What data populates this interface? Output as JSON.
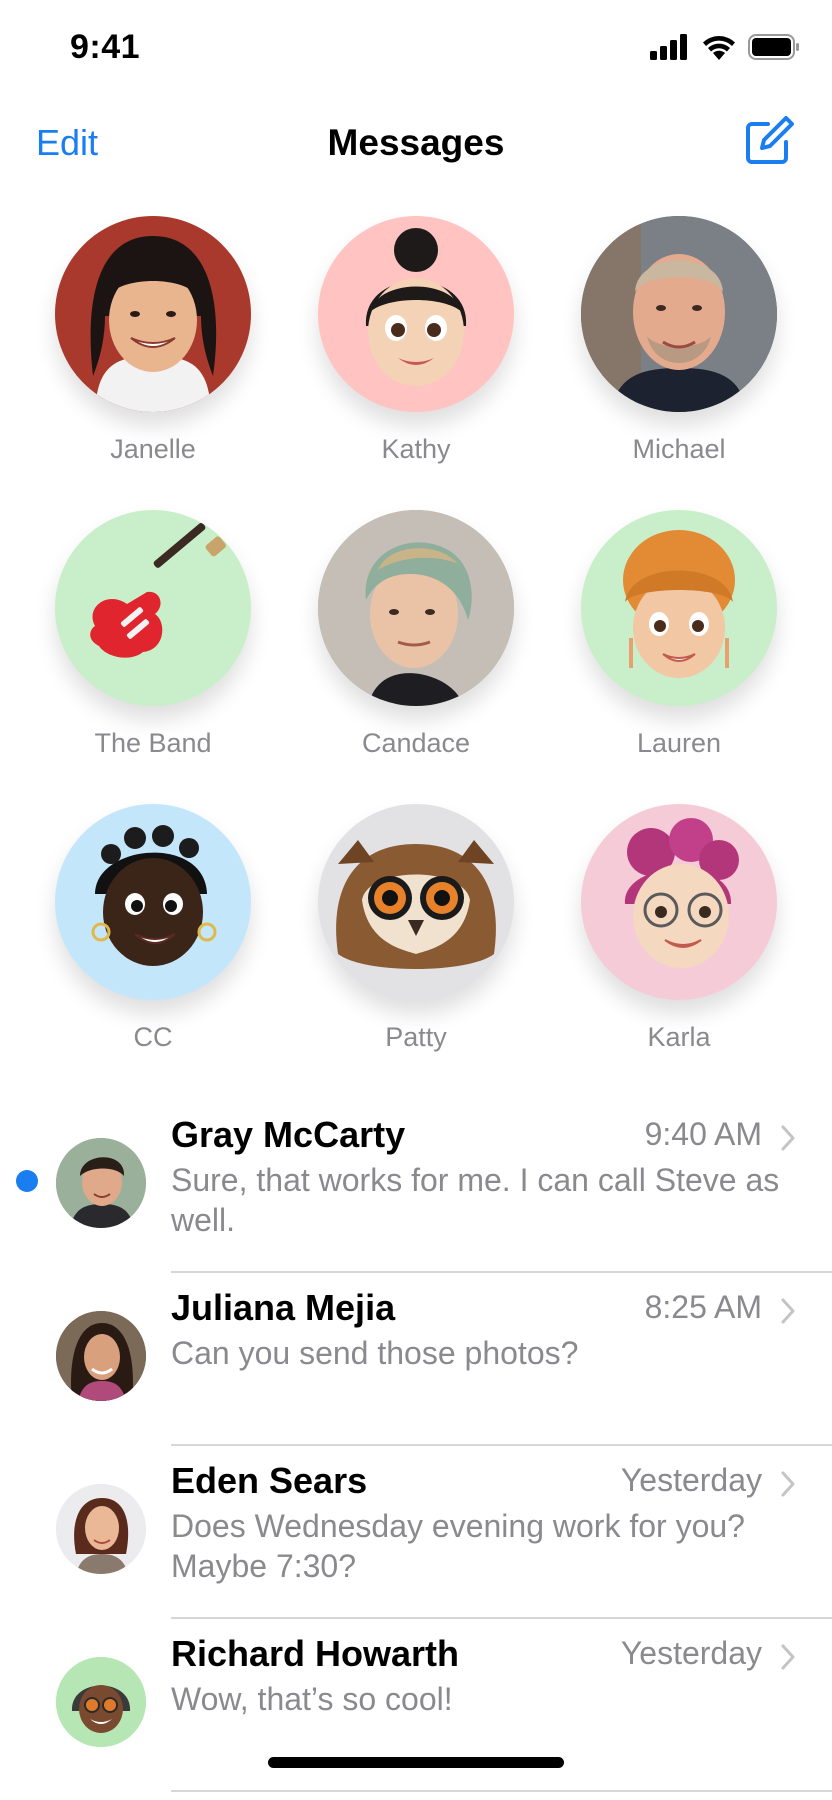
{
  "status": {
    "time": "9:41"
  },
  "nav": {
    "edit": "Edit",
    "title": "Messages"
  },
  "colors": {
    "accent": "#1a7ef0",
    "secondary_text": "#8a8a8e",
    "divider": "#d6d6d9"
  },
  "pinned": [
    {
      "name": "Janelle",
      "bg": "#a8392c"
    },
    {
      "name": "Kathy",
      "bg": "#ffc3c1"
    },
    {
      "name": "Michael",
      "bg": "#5a5f6b"
    },
    {
      "name": "The Band",
      "bg": "#c8efc9"
    },
    {
      "name": "Candace",
      "bg": "#b9b3ad"
    },
    {
      "name": "Lauren",
      "bg": "#c8efc9"
    },
    {
      "name": "CC",
      "bg": "#c4e6fb"
    },
    {
      "name": "Patty",
      "bg": "#e2e2e4"
    },
    {
      "name": "Karla",
      "bg": "#f6cbd8"
    }
  ],
  "conversations": [
    {
      "name": "Gray McCarty",
      "time": "9:40 AM",
      "message": "Sure, that works for me. I can call Steve as well.",
      "unread": true
    },
    {
      "name": "Juliana Mejia",
      "time": "8:25 AM",
      "message": "Can you send those photos?",
      "unread": false
    },
    {
      "name": "Eden Sears",
      "time": "Yesterday",
      "message": "Does Wednesday evening work for you? Maybe 7:30?",
      "unread": false
    },
    {
      "name": "Richard Howarth",
      "time": "Yesterday",
      "message": "Wow, that’s so cool!",
      "unread": false
    }
  ]
}
